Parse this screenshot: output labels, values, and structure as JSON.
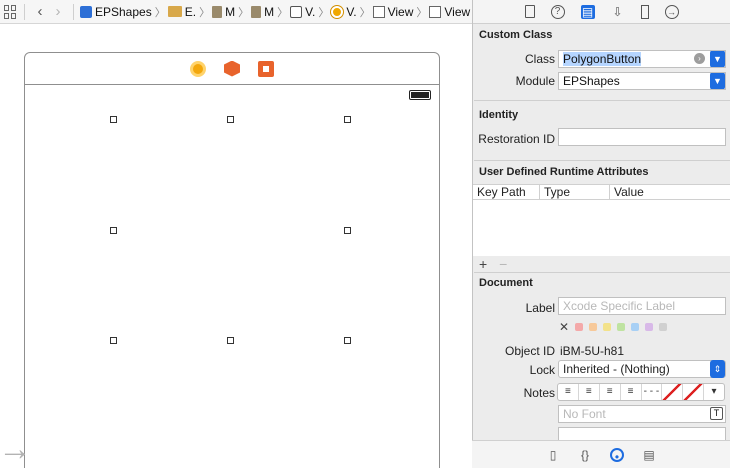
{
  "jumpbar": {
    "crumbs": [
      {
        "label": "EPShapes",
        "icon": "project-icon"
      },
      {
        "label": "E.",
        "icon": "folder-icon"
      },
      {
        "label": "M",
        "icon": "file-icon"
      },
      {
        "label": "M",
        "icon": "file-icon"
      },
      {
        "label": "V.",
        "icon": "storyboard-scene-icon"
      },
      {
        "label": "V.",
        "icon": "view-controller-icon"
      },
      {
        "label": "View",
        "icon": "view-icon"
      },
      {
        "label": "View",
        "icon": "view-icon"
      }
    ]
  },
  "inspector": {
    "custom_class": {
      "title": "Custom Class",
      "class_label": "Class",
      "class_value": "PolygonButton",
      "module_label": "Module",
      "module_value": "EPShapes"
    },
    "identity": {
      "title": "Identity",
      "restoration_label": "Restoration ID",
      "restoration_value": ""
    },
    "runtime_attributes": {
      "title": "User Defined Runtime Attributes",
      "columns": [
        "Key Path",
        "Type",
        "Value"
      ],
      "add": "+",
      "remove": "−"
    },
    "document": {
      "title": "Document",
      "label_label": "Label",
      "label_placeholder": "Xcode Specific Label",
      "clear_symbol": "✕",
      "label_colors": [
        "#f4a9a9",
        "#f7c99a",
        "#f3e28a",
        "#bfe3a1",
        "#a8d0f5",
        "#d8b9e8",
        "#d0d0d0"
      ],
      "object_id_label": "Object ID",
      "object_id_value": "iBM-5U-h81",
      "lock_label": "Lock",
      "lock_value": "Inherited - (Nothing)",
      "notes_label": "Notes",
      "font_placeholder": "No Font"
    }
  },
  "colors": {
    "accent": "#1d6ce0",
    "handle_border": "#333333"
  }
}
